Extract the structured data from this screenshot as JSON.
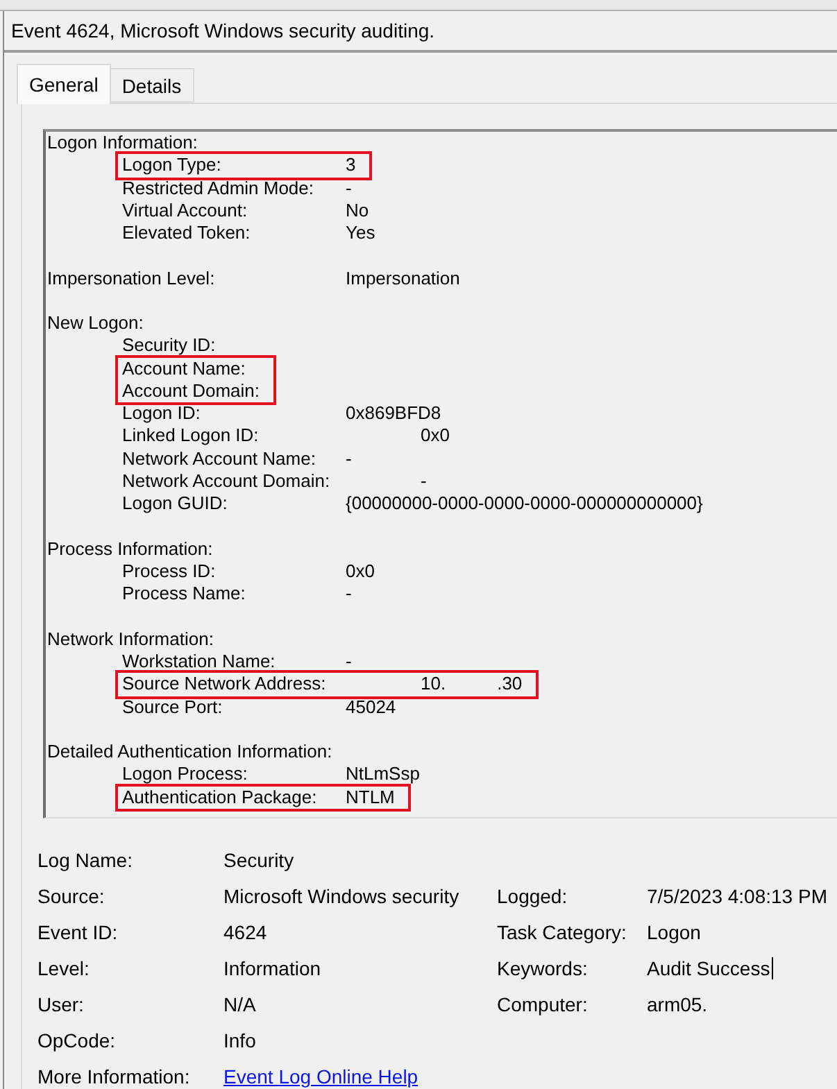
{
  "window": {
    "title": "Event 4624, Microsoft Windows security auditing."
  },
  "tabs": [
    {
      "label": "General",
      "selected": true
    },
    {
      "label": "Details",
      "selected": false
    }
  ],
  "sections": [
    {
      "title": "Logon Information:",
      "fields": [
        {
          "label": "Logon Type:",
          "value": "3",
          "highlighted": true
        },
        {
          "label": "Restricted Admin Mode:",
          "value": "-",
          "highlighted": false
        },
        {
          "label": "Virtual Account:",
          "value": "No",
          "highlighted": false
        },
        {
          "label": "Elevated Token:",
          "value": "Yes",
          "highlighted": false
        }
      ]
    },
    {
      "title": "Impersonation Level:",
      "value": "Impersonation"
    },
    {
      "title": "New Logon:",
      "fields": [
        {
          "label": "Security ID:",
          "highlighted": false
        },
        {
          "label": "Account Name:",
          "highlighted": true
        },
        {
          "label": "Account Domain:",
          "highlighted": true
        },
        {
          "label": "Logon ID:",
          "value": "0x869BFD8",
          "highlighted": false
        },
        {
          "label": "Linked Logon ID:",
          "value": "0x0",
          "highlighted": false
        },
        {
          "label": "Network Account Name:",
          "value": "-",
          "highlighted": false
        },
        {
          "label": "Network Account Domain:",
          "value": "-",
          "highlighted": false
        },
        {
          "label": "Logon GUID:",
          "value": "{00000000-0000-0000-0000-000000000000}",
          "highlighted": false
        }
      ]
    },
    {
      "title": "Process Information:",
      "fields": [
        {
          "label": "Process ID:",
          "value": "0x0",
          "highlighted": false
        },
        {
          "label": "Process Name:",
          "value": "-",
          "highlighted": false
        }
      ]
    },
    {
      "title": "Network Information:",
      "fields": [
        {
          "label": "Workstation Name:",
          "value": "-",
          "highlighted": false
        },
        {
          "label": "Source Network Address:",
          "value_parts": [
            "10.",
            ".30"
          ],
          "highlighted": true
        },
        {
          "label": "Source Port:",
          "value": "45024",
          "highlighted": false
        }
      ]
    },
    {
      "title": "Detailed Authentication Information:",
      "fields": [
        {
          "label": "Logon Process:",
          "value": "NtLmSsp",
          "highlighted": false
        },
        {
          "label": "Authentication Package:",
          "value": "NTLM",
          "highlighted": true
        }
      ]
    }
  ],
  "summary": [
    {
      "left": {
        "label": "Log Name:",
        "value": "Security",
        "kind": "text",
        "focused": false
      }
    },
    {
      "left": {
        "label": "Source:",
        "value": "Microsoft Windows security",
        "kind": "text",
        "focused": false
      },
      "right": {
        "label": "Logged:",
        "value": "7/5/2023 4:08:13 PM",
        "kind": "text",
        "focused": false
      }
    },
    {
      "left": {
        "label": "Event ID:",
        "value": "4624",
        "kind": "text",
        "focused": false
      },
      "right": {
        "label": "Task Category:",
        "value": "Logon",
        "kind": "text",
        "focused": false
      }
    },
    {
      "left": {
        "label": "Level:",
        "value": "Information",
        "kind": "text",
        "focused": false
      },
      "right": {
        "label": "Keywords:",
        "value": "Audit Success",
        "kind": "text",
        "focused": true
      }
    },
    {
      "left": {
        "label": "User:",
        "value": "N/A",
        "kind": "text",
        "focused": false
      },
      "right": {
        "label": "Computer:",
        "value": "arm05.",
        "kind": "text",
        "focused": false
      }
    },
    {
      "left": {
        "label": "OpCode:",
        "value": "Info",
        "kind": "text",
        "focused": false
      }
    },
    {
      "left": {
        "label": "More Information:",
        "value": "Event Log Online Help",
        "kind": "link",
        "focused": false
      }
    }
  ]
}
